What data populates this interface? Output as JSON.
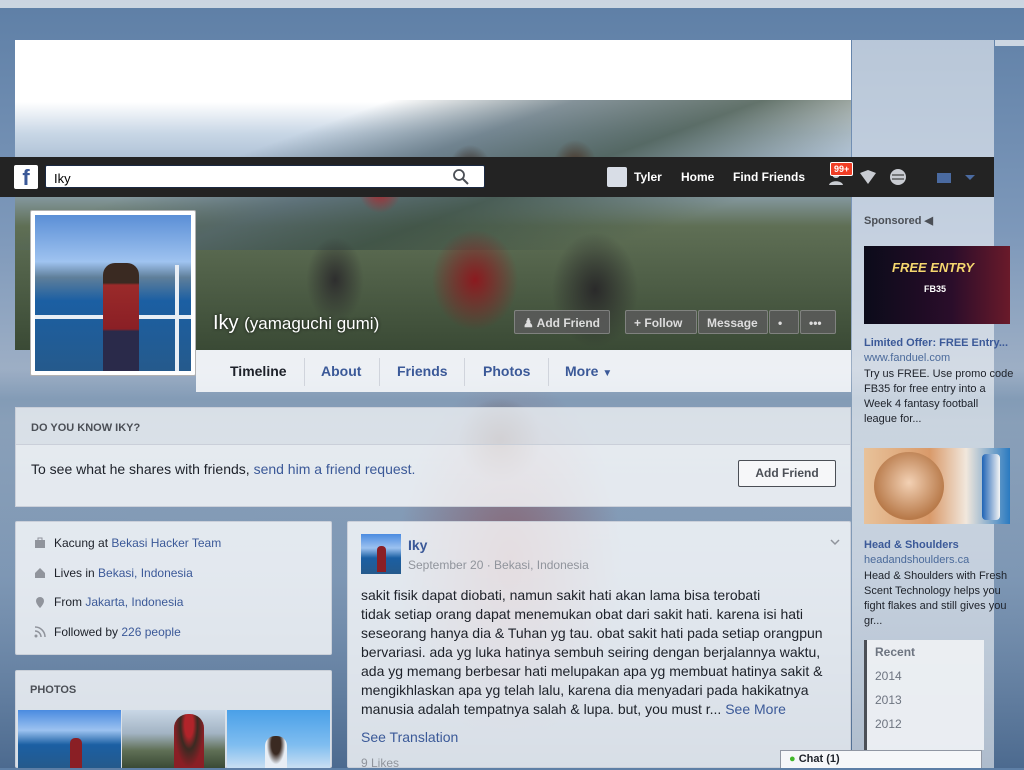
{
  "navbar": {
    "search_value": "Iky",
    "user_name": "Tyler",
    "home_label": "Home",
    "find_friends_label": "Find Friends",
    "notification_count": "99+"
  },
  "profile": {
    "name": "Iky",
    "alt_name": "(yamaguchi gumi)",
    "buttons": {
      "add_friend": "Add Friend",
      "follow": "Follow",
      "message": "Message",
      "more": "•••"
    },
    "tabs": [
      "Timeline",
      "About",
      "Friends",
      "Photos",
      "More"
    ]
  },
  "know": {
    "heading": "DO YOU KNOW IKY?",
    "text": "To see what he shares with friends,",
    "link": "send him a friend request.",
    "button": "Add Friend"
  },
  "intro": {
    "work_prefix": "Kacung at",
    "work_link": "Bekasi Hacker Team",
    "lives_prefix": "Lives in",
    "lives_link": "Bekasi, Indonesia",
    "from_prefix": "From",
    "from_link": "Jakarta, Indonesia",
    "followed_prefix": "Followed by",
    "followed_link": "226 people"
  },
  "photos": {
    "heading": "PHOTOS"
  },
  "post": {
    "author": "Iky",
    "meta": "September 20 · Bekasi, Indonesia",
    "lines": [
      "sakit fisik dapat diobati, namun sakit hati akan lama bisa terobati",
      "tidak setiap orang dapat menemukan obat dari sakit hati. karena isi hati",
      "seseorang hanya dia & Tuhan yg tau. obat sakit hati pada setiap orangpun",
      "bervariasi. ada yg luka hatinya sembuh seiring dengan berjalannya waktu,",
      "ada yg memang berbesar hati melupakan apa yg membuat hatinya sakit &",
      "mengikhlaskan apa yg telah lalu, karena dia menyadari pada hakikatnya",
      "manusia adalah tempatnya salah & lupa. but, you must r..."
    ],
    "see_more": "See More",
    "see_translation": "See Translation",
    "likes": "9 Likes"
  },
  "sidebar": {
    "sponsored": "Sponsored",
    "ad1": {
      "banner_title": "FREE ENTRY",
      "banner_sub": "FB35",
      "title": "Limited Offer: FREE Entry...",
      "url": "www.fanduel.com",
      "desc": "Try us FREE. Use promo code FB35 for free entry into a Week 4 fantasy football league for..."
    },
    "ad2": {
      "title": "Head & Shoulders",
      "url": "headandshoulders.ca",
      "desc": "Head & Shoulders with Fresh Scent Technology helps you fight flakes and still gives you gr..."
    },
    "recent": [
      "Recent",
      "2014",
      "2013",
      "2012"
    ]
  },
  "chat": {
    "label": "Chat (1)"
  },
  "colors": {
    "facebook_blue": "#3b5998",
    "navbar": "#232323",
    "badge": "#f03d25"
  }
}
